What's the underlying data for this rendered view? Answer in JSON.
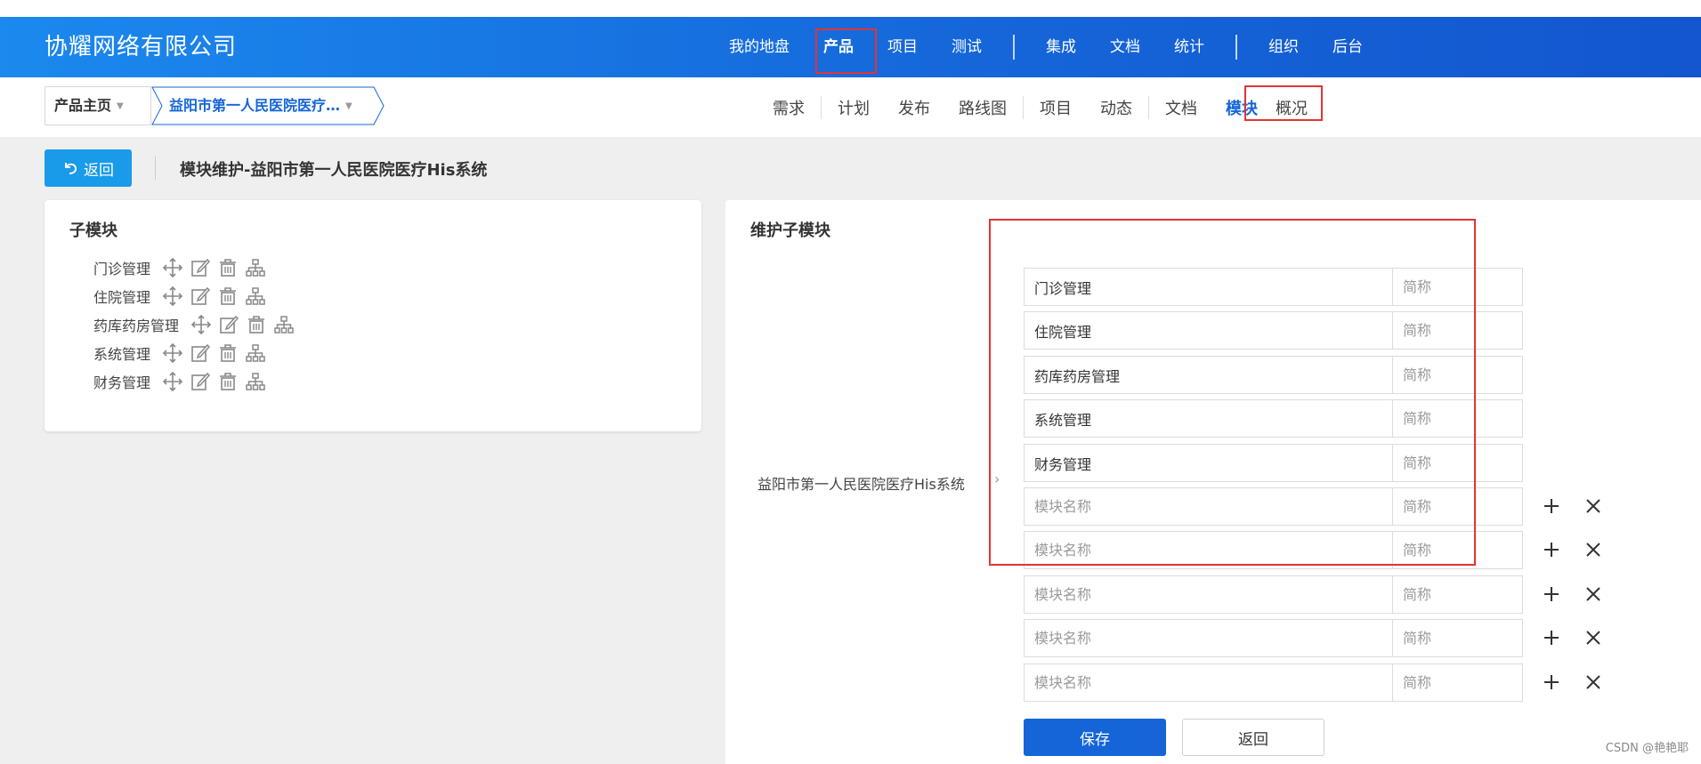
{
  "header": {
    "brand": "协耀网络有限公司",
    "nav": [
      "我的地盘",
      "产品",
      "项目",
      "测试",
      "集成",
      "文档",
      "统计",
      "组织",
      "后台"
    ],
    "active_nav": "产品"
  },
  "breadcrumb": {
    "home": "产品主页",
    "product": "益阳市第一人民医院医疗…"
  },
  "subnav": {
    "items": [
      "需求",
      "计划",
      "发布",
      "路线图",
      "项目",
      "动态",
      "文档",
      "模块",
      "概况"
    ],
    "active": "模块"
  },
  "toolbar": {
    "back_label": "返回",
    "page_title": "模块维护-益阳市第一人民医院医疗His系统"
  },
  "left_panel": {
    "title": "子模块",
    "modules": [
      "门诊管理",
      "住院管理",
      "药库药房管理",
      "系统管理",
      "财务管理"
    ],
    "action_icons": [
      "move-icon",
      "edit-icon",
      "delete-icon",
      "child-tree-icon"
    ]
  },
  "right_panel": {
    "title": "维护子模块",
    "root_module": "益阳市第一人民医院医疗His系统",
    "name_placeholder": "模块名称",
    "short_placeholder": "简称",
    "rows": [
      {
        "name": "门诊管理",
        "short": ""
      },
      {
        "name": "住院管理",
        "short": ""
      },
      {
        "name": "药库药房管理",
        "short": ""
      },
      {
        "name": "系统管理",
        "short": ""
      },
      {
        "name": "财务管理",
        "short": ""
      },
      {
        "name": "",
        "short": ""
      },
      {
        "name": "",
        "short": ""
      },
      {
        "name": "",
        "short": ""
      },
      {
        "name": "",
        "short": ""
      },
      {
        "name": "",
        "short": ""
      }
    ],
    "save_label": "保存",
    "return_label": "返回"
  },
  "watermark": "CSDN @艳艳耶",
  "colors": {
    "header_blue": "#1565d8",
    "back_button": "#199bea",
    "highlight_red": "#e23434"
  }
}
